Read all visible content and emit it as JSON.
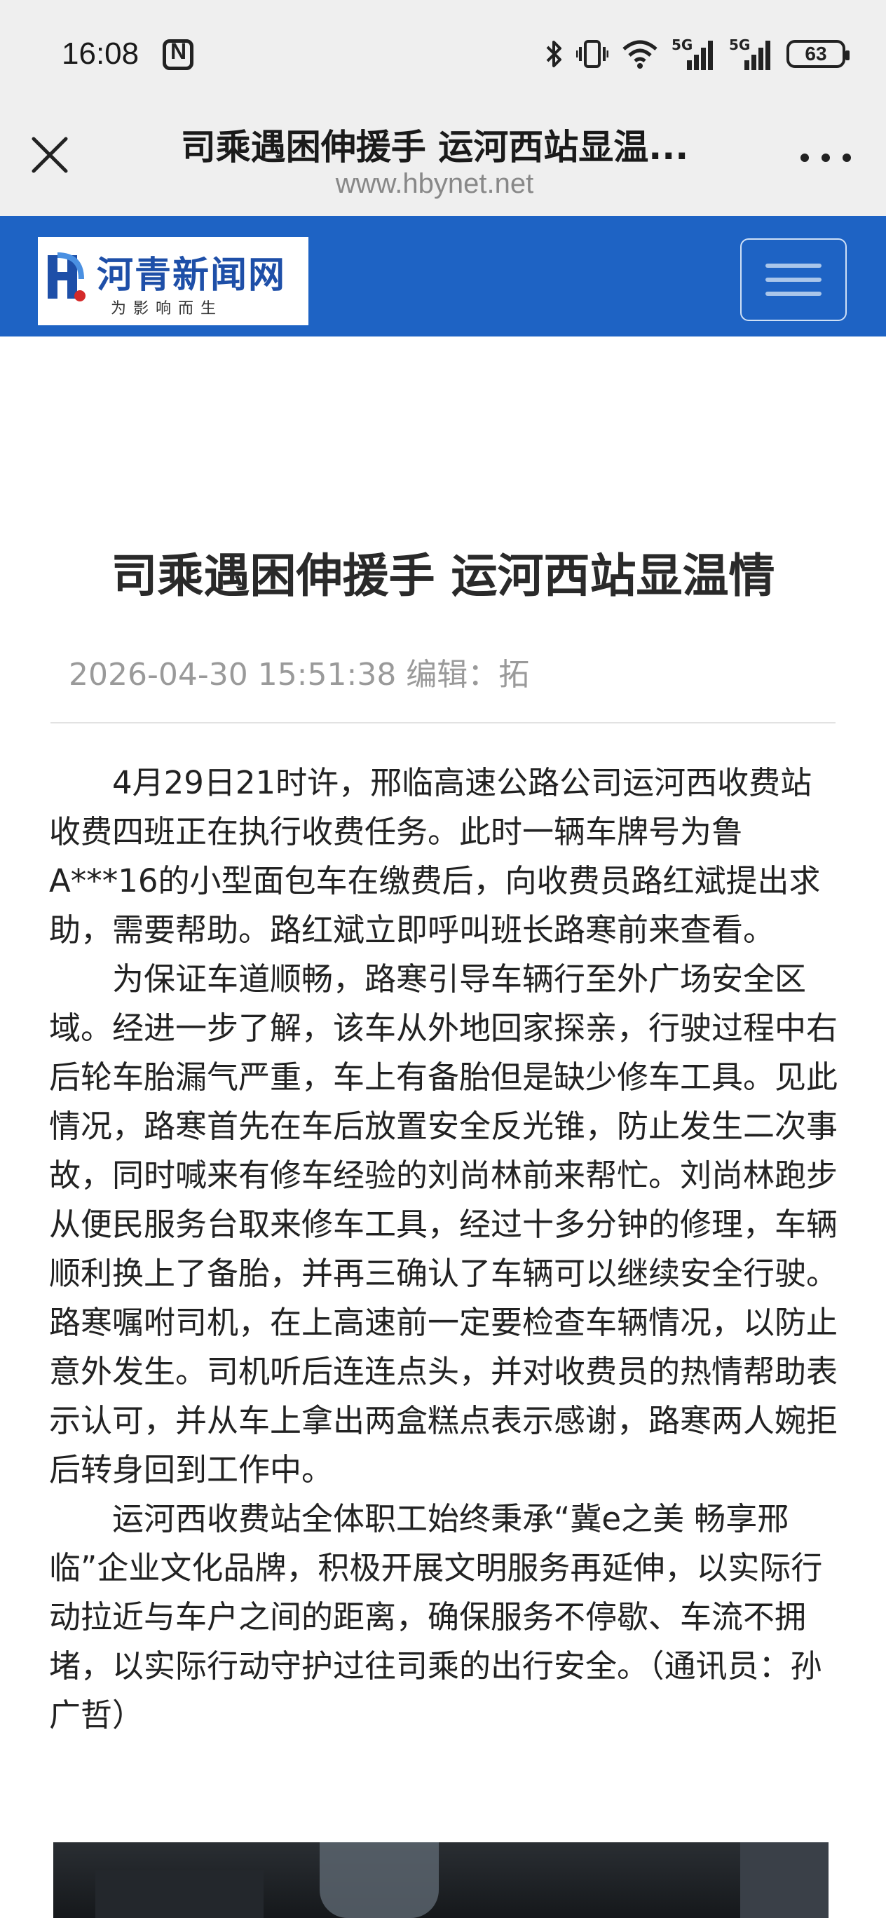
{
  "status_bar": {
    "time": "16:08",
    "network_1": "5G",
    "network_2": "5G",
    "battery": "63"
  },
  "browser": {
    "title": "司乘遇困伸援手 运河西站显温...",
    "url": "www.hbynet.net"
  },
  "site": {
    "logo_name": "河青新闻网",
    "logo_slogan": "为影响而生"
  },
  "article": {
    "title": "司乘遇困伸援手 运河西站显温情",
    "meta": "2026-04-30 15:51:38 编辑：拓",
    "paragraphs": [
      "4月29日21时许，邢临高速公路公司运河西收费站收费四班正在执行收费任务。此时一辆车牌号为鲁A***16的小型面包车在缴费后，向收费员路红斌提出求助，需要帮助。路红斌立即呼叫班长路寒前来查看。",
      "为保证车道顺畅，路寒引导车辆行至外广场安全区域。经进一步了解，该车从外地回家探亲，行驶过程中右后轮车胎漏气严重，车上有备胎但是缺少修车工具。见此情况，路寒首先在车后放置安全反光锥，防止发生二次事故，同时喊来有修车经验的刘尚林前来帮忙。刘尚林跑步从便民服务台取来修车工具，经过十多分钟的修理，车辆顺利换上了备胎，并再三确认了车辆可以继续安全行驶。路寒嘱咐司机，在上高速前一定要检查车辆情况，以防止意外发生。司机听后连连点头，并对收费员的热情帮助表示认可，并从车上拿出两盒糕点表示感谢，路寒两人婉拒后转身回到工作中。",
      "运河西收费站全体职工始终秉承“冀e之美 畅享邢临”企业文化品牌，积极开展文明服务再延伸，以实际行动拉近与车户之间的距离，确保服务不停歇、车流不拥堵，以实际行动守护过往司乘的出行安全。（通讯员：孙广哲）"
    ]
  },
  "icons": {
    "close": "close-icon",
    "more": "more-icon",
    "menu": "hamburger-menu-icon",
    "bluetooth": "bluetooth-icon",
    "vibrate": "vibrate-icon",
    "wifi": "wifi-icon",
    "nfc": "nfc-icon"
  },
  "colors": {
    "header_blue": "#1e63c4",
    "logo_blue": "#1e4fa8",
    "logo_red": "#d42a2a"
  }
}
